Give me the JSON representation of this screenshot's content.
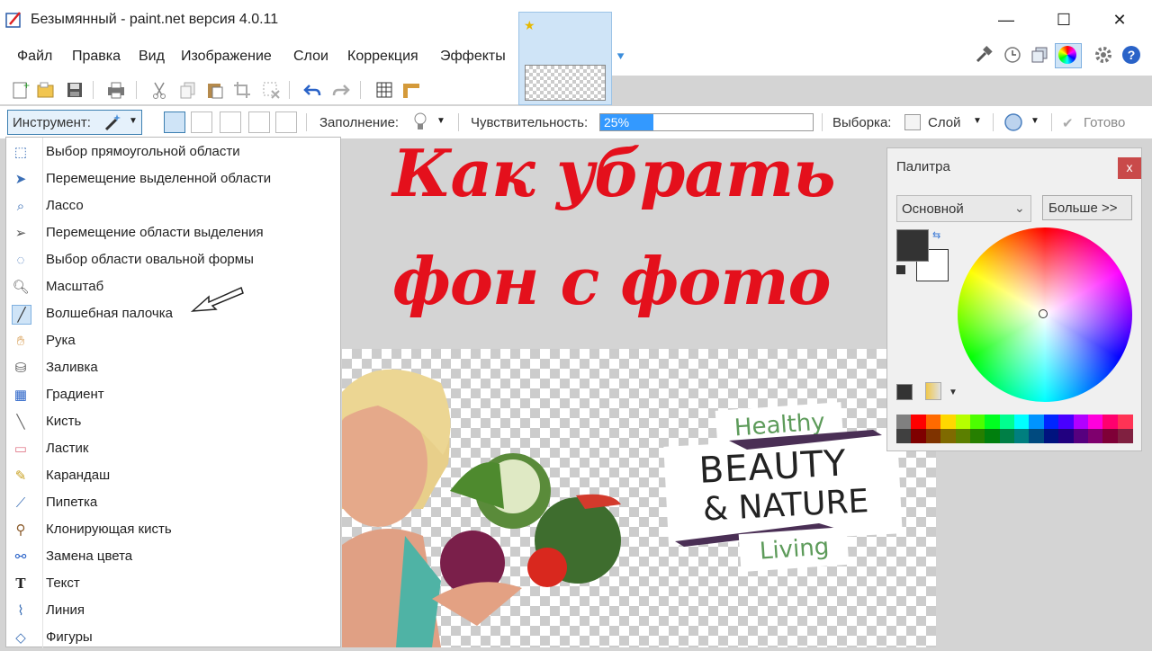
{
  "window": {
    "title": "Безымянный - paint.net версия 4.0.11",
    "minimize": "—",
    "maximize": "☐",
    "close": "✕"
  },
  "menu": [
    "Файл",
    "Правка",
    "Вид",
    "Изображение",
    "Слои",
    "Коррекция",
    "Эффекты"
  ],
  "toolbar2": {
    "tool_label": "Инструмент:",
    "fill_label": "Заполнение:",
    "tolerance_label": "Чувствительность:",
    "tolerance_value": "25%",
    "tolerance_fraction": 0.25,
    "sampling_label": "Выборка:",
    "sampling_value": "Слой",
    "done_label": "Готово"
  },
  "tools": [
    {
      "label": "Выбор прямоугольной области",
      "icon": "rectangle-select-icon"
    },
    {
      "label": "Перемещение выделенной области",
      "icon": "move-selected-icon"
    },
    {
      "label": "Лассо",
      "icon": "lasso-icon"
    },
    {
      "label": "Перемещение области выделения",
      "icon": "move-selection-icon"
    },
    {
      "label": "Выбор области овальной формы",
      "icon": "ellipse-select-icon"
    },
    {
      "label": "Масштаб",
      "icon": "zoom-icon"
    },
    {
      "label": "Волшебная палочка",
      "icon": "magic-wand-icon"
    },
    {
      "label": "Рука",
      "icon": "hand-icon"
    },
    {
      "label": "Заливка",
      "icon": "bucket-icon"
    },
    {
      "label": "Градиент",
      "icon": "gradient-icon"
    },
    {
      "label": "Кисть",
      "icon": "brush-icon"
    },
    {
      "label": "Ластик",
      "icon": "eraser-icon"
    },
    {
      "label": "Карандаш",
      "icon": "pencil-icon"
    },
    {
      "label": "Пипетка",
      "icon": "color-picker-icon"
    },
    {
      "label": "Клонирующая кисть",
      "icon": "clone-stamp-icon"
    },
    {
      "label": "Замена цвета",
      "icon": "recolor-icon"
    },
    {
      "label": "Текст",
      "icon": "text-icon"
    },
    {
      "label": "Линия",
      "icon": "line-icon"
    },
    {
      "label": "Фигуры",
      "icon": "shapes-icon"
    }
  ],
  "overlay_title": {
    "line1": "Как убрать",
    "line2": "фон с фото",
    "color": "#e4101c"
  },
  "logo": {
    "healthy": "Healthy",
    "beauty": "BEAUTY",
    "nature": "& NATURE",
    "living": "Living"
  },
  "palette": {
    "title": "Палитра",
    "close": "x",
    "mode": "Основной",
    "more_button": "Больше >>",
    "primary_color": "#333333",
    "secondary_color": "#ffffff",
    "swatches": [
      "#808080",
      "#ff0000",
      "#ff6a00",
      "#ffd800",
      "#b6ff00",
      "#4cff00",
      "#00ff21",
      "#00ff90",
      "#00ffff",
      "#0094ff",
      "#0026ff",
      "#4800ff",
      "#b200ff",
      "#ff00dc",
      "#ff006e",
      "#ff3355"
    ],
    "swatches_dark": [
      "#404040",
      "#7f0000",
      "#7f3300",
      "#7f6a00",
      "#5b7f00",
      "#267f00",
      "#007f0e",
      "#007f46",
      "#007f7f",
      "#004a7f",
      "#00137f",
      "#21007f",
      "#57007f",
      "#7f006e",
      "#7f0037",
      "#802040"
    ]
  }
}
